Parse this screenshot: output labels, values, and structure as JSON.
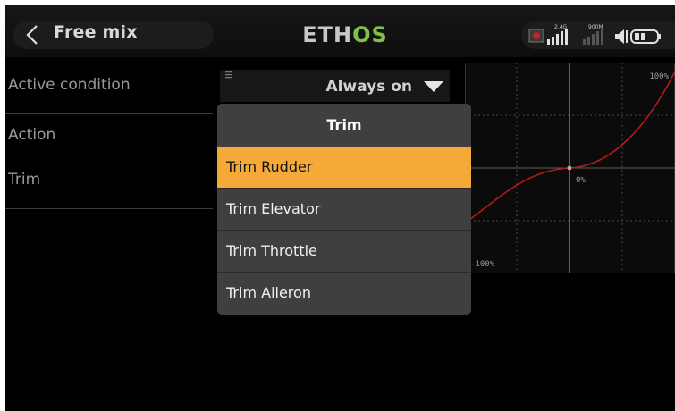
{
  "header": {
    "title": "Free mix",
    "logo": "ETHOS",
    "status": {
      "band1": "2.4G",
      "band2": "900M",
      "icons": [
        "record-icon",
        "signal-icon",
        "signal-icon",
        "speaker-icon",
        "battery-icon"
      ]
    }
  },
  "rows": [
    {
      "label": "Active condition"
    },
    {
      "label": "Action"
    },
    {
      "label": "Trim"
    }
  ],
  "condition": {
    "value": "Always on"
  },
  "curve": {
    "labels": {
      "top_right": "100%",
      "center": "0%",
      "bottom_left": "-100%"
    },
    "colors": {
      "curve": "#b01a1a",
      "center_axis": "#d78b1a",
      "grid": "#4a4a4a"
    }
  },
  "popup": {
    "title": "Trim",
    "options": [
      "Trim Rudder",
      "Trim Elevator",
      "Trim Throttle",
      "Trim Aileron"
    ],
    "selected": "Trim Rudder"
  },
  "colors": {
    "accent": "#f5a938",
    "logo_accent": "#7fc242"
  }
}
